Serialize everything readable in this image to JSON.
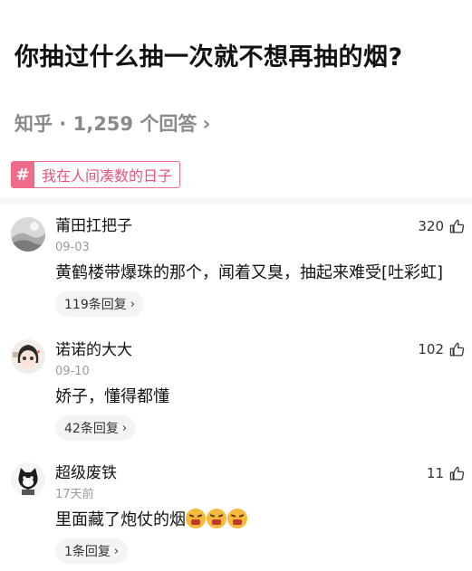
{
  "question": {
    "title": "你抽过什么抽一次就不想再抽的烟?"
  },
  "source": {
    "text": "知乎 · 1,259 个回答",
    "chevron": "›"
  },
  "topic": {
    "label": "我在人间凑数的日子",
    "icon": "hash-icon"
  },
  "comments": [
    {
      "name": "莆田扛把子",
      "time": "09-03",
      "text": "黄鹤楼带爆珠的那个，闻着又臭，抽起来难受[吐彩虹]",
      "likes": "320",
      "replies": "119条回复"
    },
    {
      "name": "诺诺的大大",
      "time": "09-10",
      "text": "娇子，懂得都懂",
      "likes": "102",
      "replies": "42条回复"
    },
    {
      "name": "超级废铁",
      "time": "17天前",
      "text": "里面藏了炮仗的烟",
      "likes": "11",
      "replies": "1条回复"
    }
  ],
  "icons": {
    "like": "thumbs-up-icon",
    "emoji": "angry-face-emoji"
  },
  "colors": {
    "accent": "#f06b8a",
    "text": "#121212",
    "muted": "#9a9a9a"
  }
}
